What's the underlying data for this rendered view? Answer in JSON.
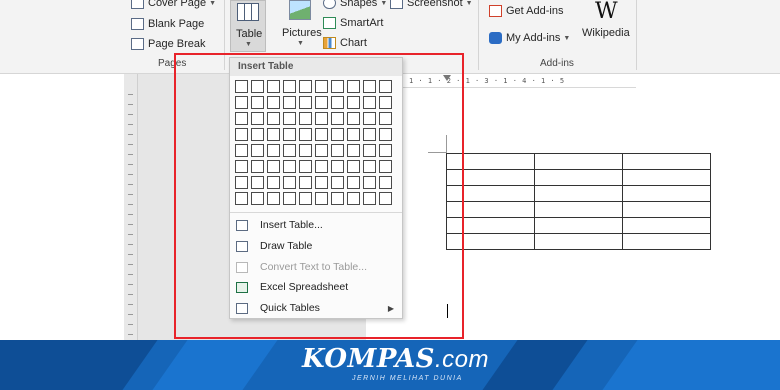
{
  "ribbon": {
    "pages_group": {
      "cover_page": "Cover Page",
      "blank_page": "Blank Page",
      "page_break": "Page Break",
      "label": "Pages"
    },
    "table_button": "Table",
    "illustrations": {
      "pictures": "Pictures",
      "shapes": "Shapes",
      "smartart": "SmartArt",
      "chart": "Chart",
      "screenshot": "Screenshot"
    },
    "addins_group": {
      "get_addins": "Get Add-ins",
      "my_addins": "My Add-ins",
      "wikipedia": "Wikipedia",
      "wikipedia_logo": "W",
      "label": "Add-ins"
    }
  },
  "ruler": {
    "horizontal_text": "1 · 1 · 2 · 1 · 3 · 1 · 4 · 1 · 5"
  },
  "insert_table_menu": {
    "title": "Insert Table",
    "grid": {
      "columns": 10,
      "rows": 8
    },
    "items": [
      {
        "label": "Insert Table...",
        "icon": "table-icon",
        "enabled": true,
        "submenu": false
      },
      {
        "label": "Draw Table",
        "icon": "pencil-icon",
        "enabled": true,
        "submenu": false
      },
      {
        "label": "Convert Text to Table...",
        "icon": "convert-icon",
        "enabled": false,
        "submenu": false
      },
      {
        "label": "Excel Spreadsheet",
        "icon": "excel-icon",
        "enabled": true,
        "submenu": false
      },
      {
        "label": "Quick Tables",
        "icon": "quick-tables-icon",
        "enabled": true,
        "submenu": true
      }
    ]
  },
  "document_table": {
    "columns": 3,
    "rows": 6
  },
  "footer": {
    "brand": "KOMPAS",
    "brand_suffix": ".com",
    "tagline": "JERNIH MELIHAT DUNIA"
  },
  "colors": {
    "highlight": "#e8232a",
    "footer_bg": "#1565b8",
    "ribbon_bg": "#f3f3f3"
  }
}
